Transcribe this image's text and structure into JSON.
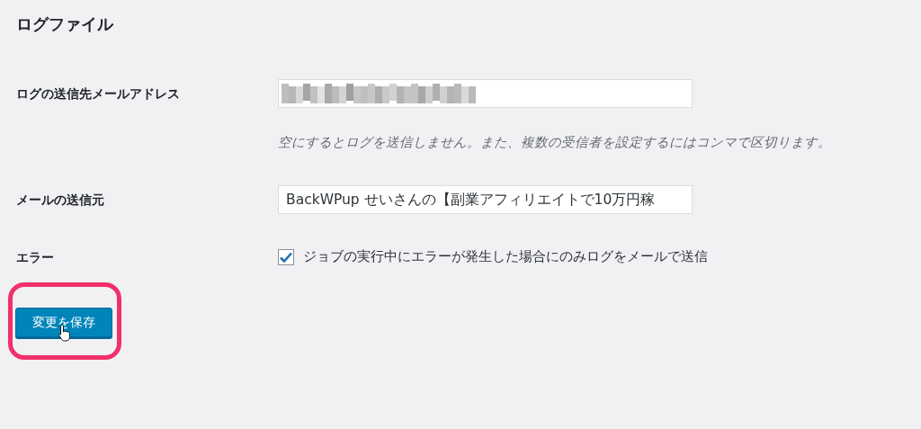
{
  "section_title": "ログファイル",
  "rows": [
    {
      "kind": "email",
      "label": "ログの送信先メールアドレス",
      "description": "空にするとログを送信しません。また、複数の受信者を設定するにはコンマで区切ります。"
    },
    {
      "kind": "text",
      "label": "メールの送信元",
      "value": "BackWPup せいさんの【副業アフィリエイトで10万円稼"
    },
    {
      "kind": "checkbox",
      "label": "エラー",
      "checked": true,
      "option": "ジョブの実行中にエラーが発生した場合にのみログをメールで送信"
    }
  ],
  "save_button": {
    "label": "変更を保存",
    "highlighted": true
  }
}
